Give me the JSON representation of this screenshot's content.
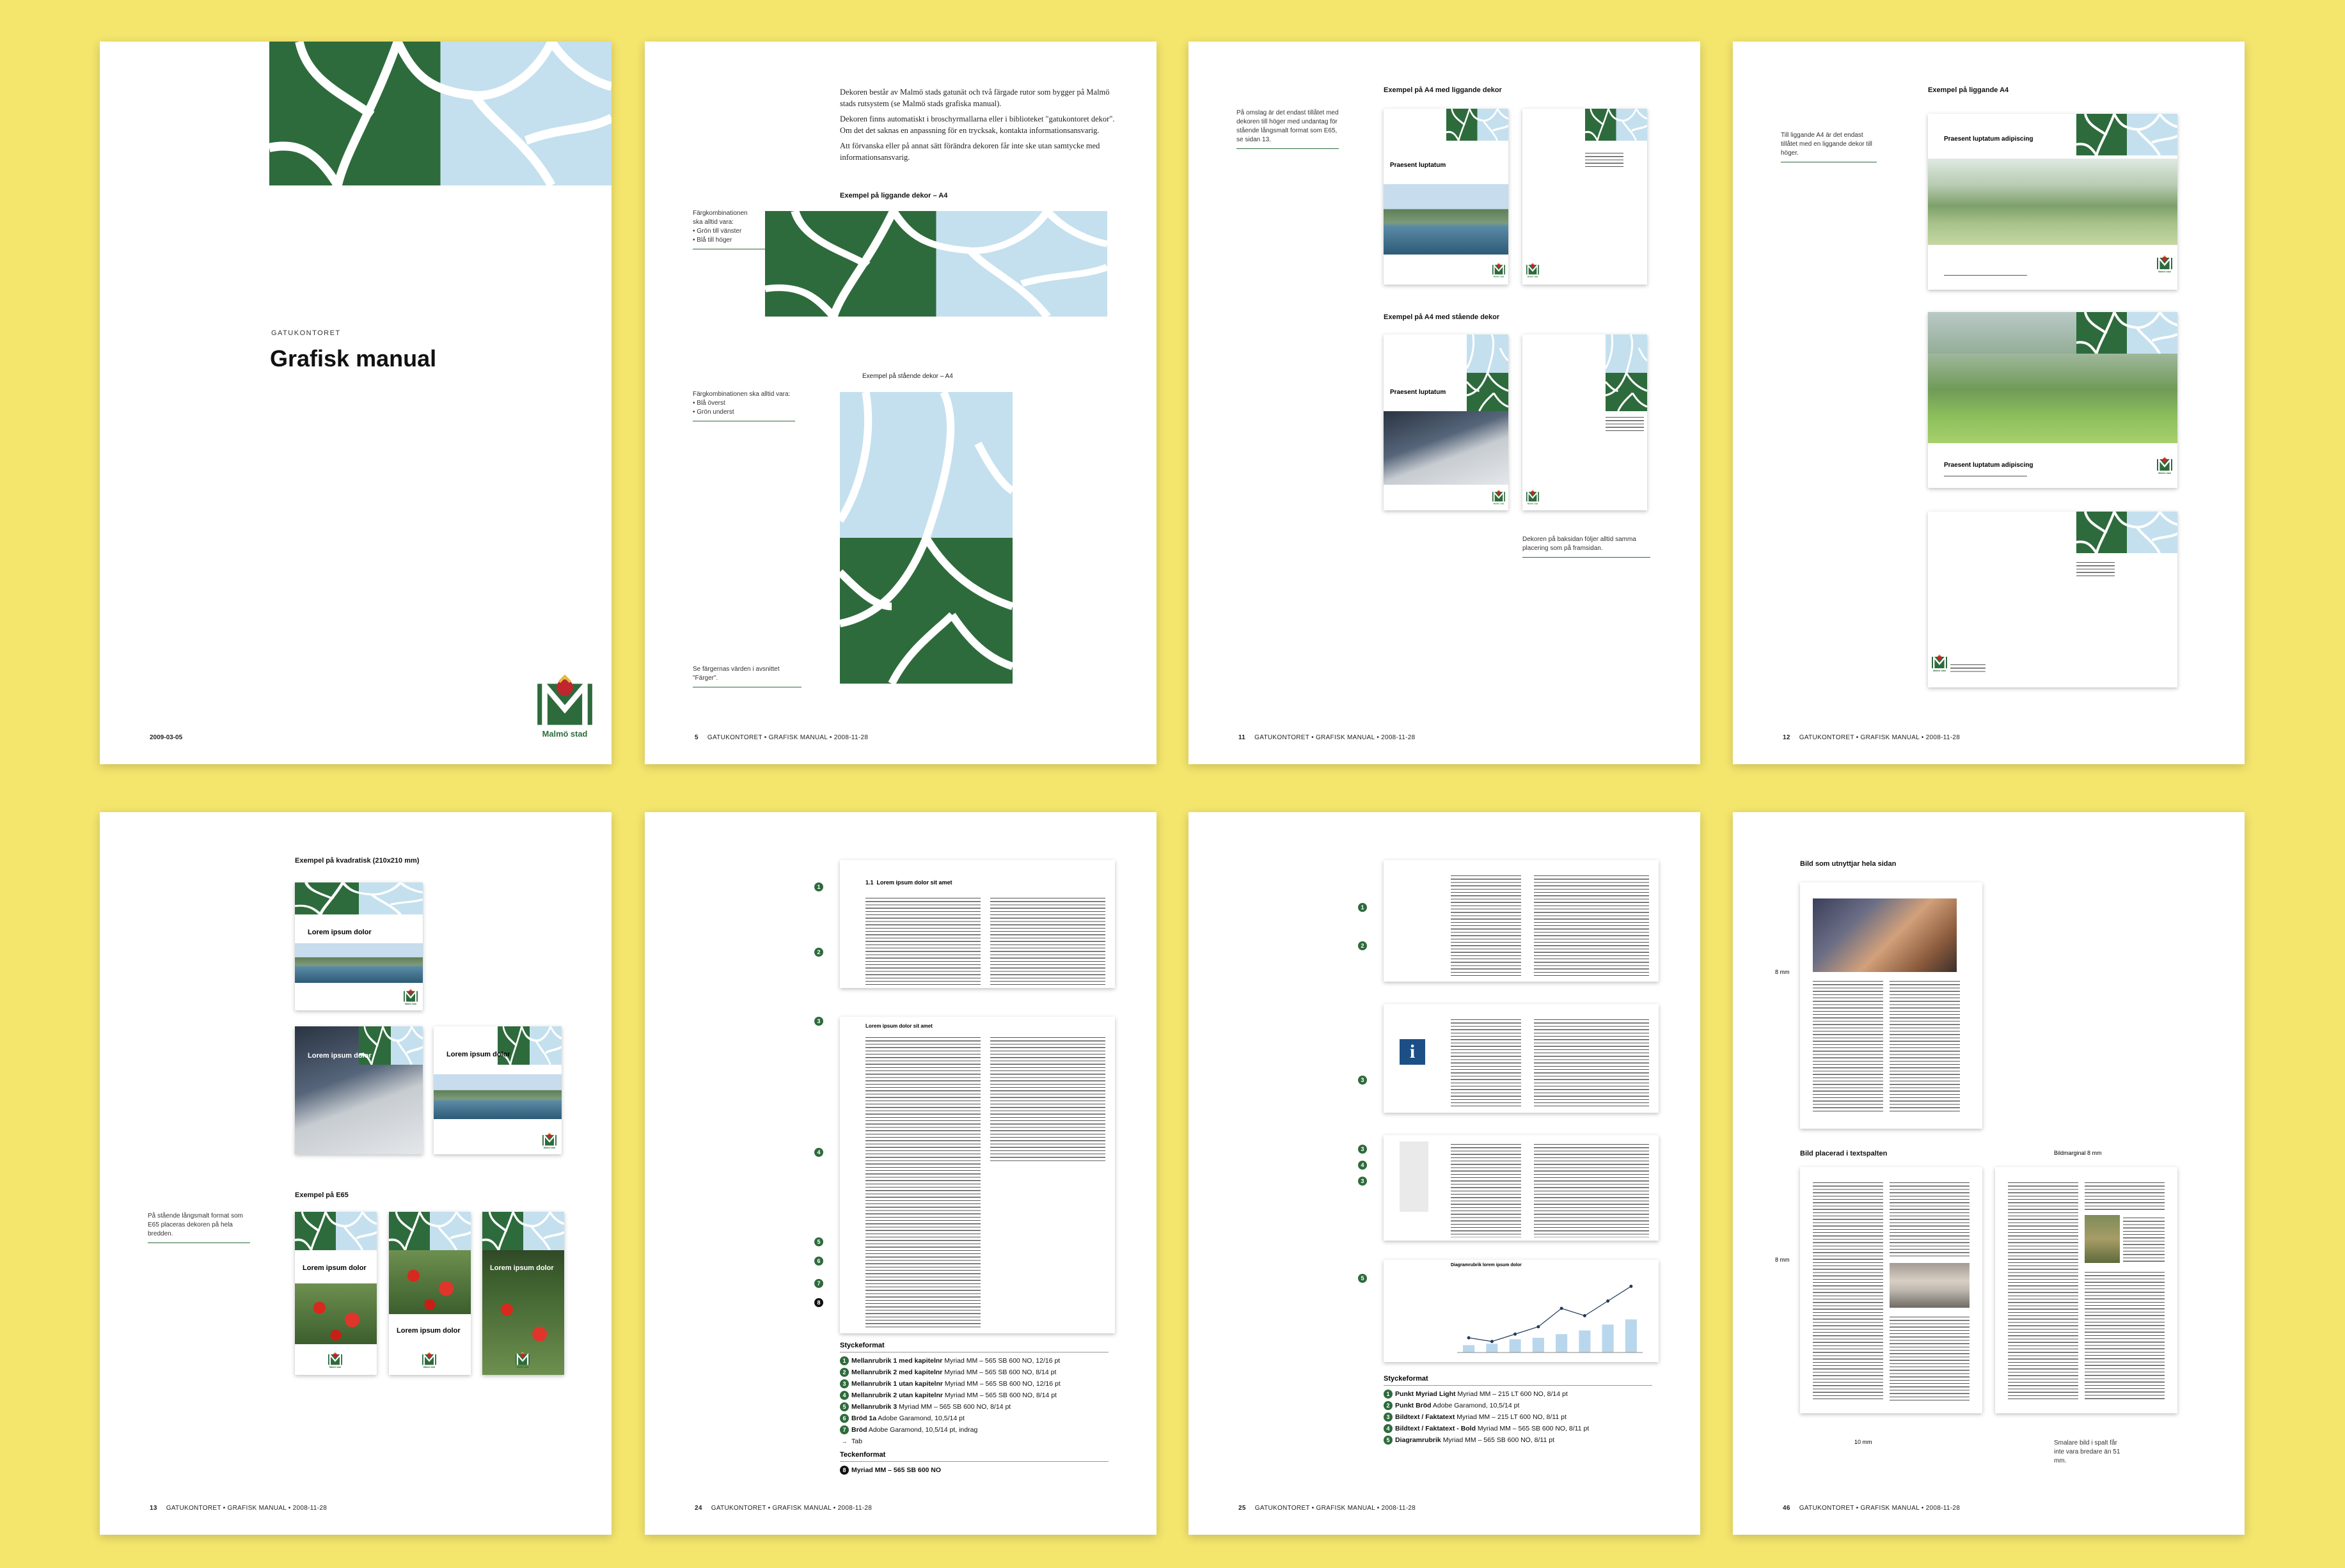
{
  "colors": {
    "background": "#f4e56d",
    "green": "#2e6b3c",
    "lightblue": "#c4e0ee",
    "white": "#ffffff"
  },
  "page1": {
    "dept": "GATUKONTORET",
    "title": "Grafisk manual",
    "date": "2009-03-05",
    "logo_text": "Malmö stad"
  },
  "page2": {
    "body": [
      "Dekoren består av Malmö stads gatunät och två färgade rutor som bygger på Malmö stads rutsystem (se Malmö stads grafiska manual).",
      "Dekoren finns automatiskt i broschyrmallarna eller i biblioteket \"gatukontoret dekor\". Om det det saknas en anpassning för en trycksak, kontakta informationsansvarig.",
      "Att förvanska eller på annat sätt förändra dekoren får inte ske utan samtycke med informationsansvarig."
    ],
    "heading_landscape": "Exempel på liggande dekor – A4",
    "caption_landscape": [
      "Färgkombinationen",
      "ska alltid vara:",
      "• Grön till vänster",
      "• Blå till höger"
    ],
    "heading_portrait": "Exempel på stående dekor – A4",
    "caption_portrait": [
      "Färgkombinationen ska alltid vara:",
      "• Blå överst",
      "• Grön underst"
    ],
    "caption_colors": "Se färgernas värden i avsnittet \"Färger\".",
    "footer": {
      "num": "5",
      "text": "GATUKONTORET  •  GRAFISK MANUAL  •  2008-11-28"
    }
  },
  "page3": {
    "caption_top": "På omslag är det endast tillåtet med dekoren till höger med undantag för stående långsmalt format som E65, se sidan 13.",
    "heading1": "Exempel på A4 med liggande dekor",
    "heading2": "Exempel på A4 med stående dekor",
    "cover_title": "Praesent luptatum",
    "caption_bottom": "Dekoren på baksidan följer alltid samma placering som på framsidan.",
    "footer": {
      "num": "11",
      "text": "GATUKONTORET  •  GRAFISK MANUAL  •  2008-11-28"
    }
  },
  "page4": {
    "caption": "Till liggande A4 är det endast tillåtet med en liggande dekor till höger.",
    "heading": "Exempel på liggande A4",
    "cover_title": "Praesent luptatum adipiscing",
    "footer": {
      "num": "12",
      "text": "GATUKONTORET  •  GRAFISK MANUAL  •  2008-11-28"
    }
  },
  "page5": {
    "heading1": "Exempel på kvadratisk (210x210 mm)",
    "heading2": "Exempel på E65",
    "cover_title": "Lorem ipsum dolor",
    "caption": "På stående långsmalt format som E65 placeras dekoren på hela bredden.",
    "footer": {
      "num": "13",
      "text": "GATUKONTORET  •  GRAFISK MANUAL  •  2008-11-28"
    }
  },
  "page6": {
    "section1_num": "1.1",
    "section1_title": "Lorem ipsum dolor sit amet",
    "section2_title": "Lorem ipsum dolor sit amet",
    "legend_title": "Styckeformat",
    "legend": [
      {
        "n": "1",
        "bold": "Mellanrubrik 1 med kapitelnr",
        "rest": " Myriad MM – 565 SB 600 NO, 12/16 pt"
      },
      {
        "n": "2",
        "bold": "Mellanrubrik 2 med kapitelnr",
        "rest": " Myriad MM – 565 SB 600 NO, 8/14 pt"
      },
      {
        "n": "3",
        "bold": "Mellanrubrik 1 utan kapitelnr",
        "rest": " Myriad MM – 565 SB 600 NO, 12/16 pt"
      },
      {
        "n": "4",
        "bold": "Mellanrubrik 2 utan kapitelnr",
        "rest": " Myriad MM – 565 SB 600 NO, 8/14 pt"
      },
      {
        "n": "5",
        "bold": "Mellanrubrik 3",
        "rest": " Myriad MM – 565 SB 600 NO, 8/14 pt"
      },
      {
        "n": "6",
        "bold": "Bröd 1a",
        "rest": " Adobe Garamond, 10,5/14 pt"
      },
      {
        "n": "7",
        "bold": "Bröd",
        "rest": " Adobe Garamond, 10,5/14 pt, indrag"
      },
      {
        "n": "→",
        "bold": "",
        "rest": "Tab"
      }
    ],
    "legend2_title": "Teckenformat",
    "legend2": [
      {
        "n": "8",
        "bold": "Myriad MM – 565 SB 600 NO",
        "rest": ""
      }
    ],
    "footer": {
      "num": "24",
      "text": "GATUKONTORET  •  GRAFISK MANUAL  •  2008-11-28"
    }
  },
  "page7": {
    "legend_title": "Styckeformat",
    "legend": [
      {
        "n": "1",
        "bold": "Punkt Myriad Light",
        "rest": " Myriad MM – 215 LT 600 NO, 8/14 pt"
      },
      {
        "n": "2",
        "bold": "Punkt Bröd",
        "rest": " Adobe Garamond, 10,5/14 pt"
      },
      {
        "n": "3",
        "bold": "Bildtext / Faktatext",
        "rest": " Myriad MM – 215 LT 600 NO, 8/11 pt"
      },
      {
        "n": "4",
        "bold": "Bildtext / Faktatext - Bold",
        "rest": " Myriad MM – 565 SB 600 NO, 8/11 pt"
      },
      {
        "n": "5",
        "bold": "Diagramrubrik",
        "rest": " Myriad MM – 565 SB 600 NO, 8/11 pt"
      }
    ],
    "info_label": "i",
    "chart_title": "Diagramrubrik lorem ipsum dolor",
    "footer": {
      "num": "25",
      "text": "GATUKONTORET  •  GRAFISK MANUAL  •  2008-11-28"
    }
  },
  "page8": {
    "heading1": "Bild som utnyttjar hela sidan",
    "heading2": "Bild placerad i textspalten",
    "label_8mm_a": "8 mm",
    "label_8mm_b": "8 mm",
    "label_bildmarginal": "Bildmarginal 8 mm",
    "label_10mm": "10 mm",
    "caption": "Smalare bild i spalt får inte vara bredare än 51 mm.",
    "footer": {
      "num": "46",
      "text": "GATUKONTORET  •  GRAFISK MANUAL  •  2008-11-28"
    }
  },
  "chart_data": {
    "type": "line",
    "series": [
      {
        "values": [
          2,
          1.5,
          2.5,
          3.5,
          6,
          5,
          7,
          9
        ]
      },
      {
        "values": [
          1,
          1.2,
          1.8,
          2,
          2.5,
          3,
          3.8,
          4.5
        ]
      }
    ]
  }
}
